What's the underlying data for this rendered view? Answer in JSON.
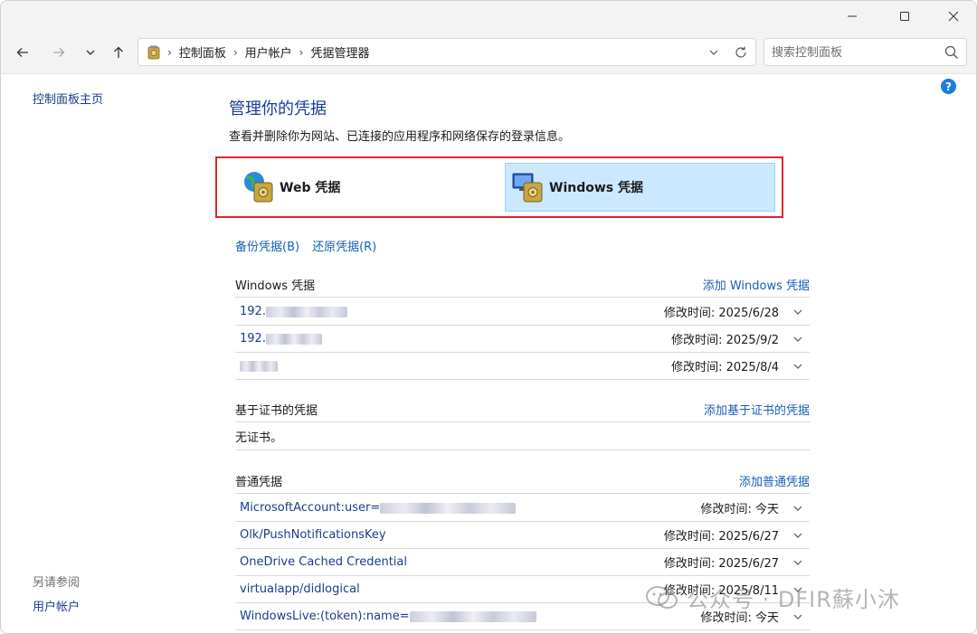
{
  "window": {
    "controls": {
      "minimize": "minimize",
      "maximize": "maximize",
      "close": "close"
    }
  },
  "nav": {
    "breadcrumbs": [
      "控制面板",
      "用户帐户",
      "凭据管理器"
    ],
    "search_placeholder": "搜索控制面板"
  },
  "sidebar": {
    "home": "控制面板主页",
    "see_also_label": "另请参阅",
    "see_also_item": "用户帐户"
  },
  "main": {
    "title": "管理你的凭据",
    "description": "查看并删除你为网站、已连接的应用程序和网络保存的登录信息。",
    "type_web": "Web 凭据",
    "type_windows": "Windows 凭据",
    "backup_link": "备份凭据(B)",
    "restore_link": "还原凭据(R)"
  },
  "windows_section": {
    "title": "Windows 凭据",
    "add": "添加 Windows 凭据",
    "rows": [
      {
        "prefix": "192.",
        "modified": "修改时间: 2025/6/28"
      },
      {
        "prefix": "192.",
        "modified": "修改时间: 2025/9/2"
      },
      {
        "prefix": "",
        "modified": "修改时间: 2025/8/4"
      }
    ]
  },
  "cert_section": {
    "title": "基于证书的凭据",
    "add": "添加基于证书的凭据",
    "empty": "无证书。"
  },
  "generic_section": {
    "title": "普通凭据",
    "add": "添加普通凭据",
    "rows": [
      {
        "name": "MicrosoftAccount:user=",
        "modified": "修改时间: 今天"
      },
      {
        "name": "Olk/PushNotificationsKey",
        "modified": "修改时间: 2025/6/27"
      },
      {
        "name": "OneDrive Cached Credential",
        "modified": "修改时间: 2025/6/27"
      },
      {
        "name": "virtualapp/didlogical",
        "modified": "修改时间: 2025/8/11"
      },
      {
        "name": "WindowsLive:(token):name=",
        "modified": "修改时间: 今天"
      }
    ]
  },
  "watermark": {
    "text": "公众号 · DFIR蘇小沐"
  },
  "colors": {
    "link": "#1a5fb4",
    "title_blue": "#1a3d8f",
    "highlight": "#e0262d",
    "selected_bg": "#cce8ff"
  }
}
